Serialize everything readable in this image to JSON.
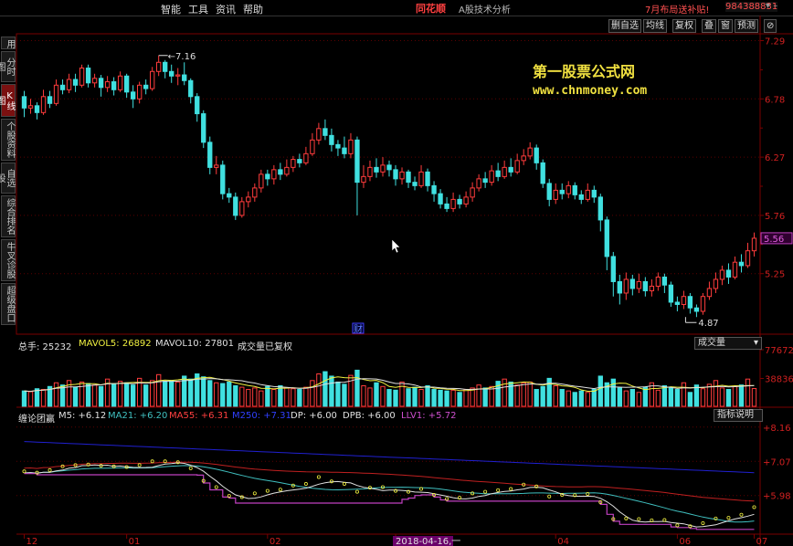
{
  "menu": {
    "items": [
      "智能",
      "工具",
      "资讯",
      "帮助"
    ],
    "brand": "同花顺",
    "subtitle": "A股技术分析",
    "promo": "7月布局送补贴!",
    "hotline": "984388831"
  },
  "sidebar": [
    {
      "label": "用",
      "active": false
    },
    {
      "label": "分时图",
      "active": false
    },
    {
      "label": "K线图",
      "active": true
    },
    {
      "label": "个股资料",
      "active": false
    },
    {
      "label": "自选股",
      "active": false
    },
    {
      "label": "综合排名",
      "active": false
    },
    {
      "label": "牛叉诊股",
      "active": false
    },
    {
      "label": "超级盘口",
      "active": false
    }
  ],
  "toolbar": [
    "删自选",
    "均线",
    "复权",
    "叠",
    "窗",
    "预测",
    "⊘"
  ],
  "watermark": {
    "line1": "第一股票公式网",
    "line2": "www.chnmoney.com"
  },
  "price_axis": {
    "ticks": [
      "7.29",
      "6.78",
      "6.27",
      "5.76",
      "5.25"
    ],
    "current": "5.56"
  },
  "annotations": {
    "high": "7.16",
    "low": "4.87",
    "cai": "财"
  },
  "volume_header": {
    "total": "总手: 25232",
    "mavol5": "MAVOL5: 26892",
    "mavol10": "MAVOL10: 27801",
    "note": "成交量已复权",
    "dropdown": "成交量"
  },
  "volume_axis": {
    "ticks": [
      "77672",
      "38836"
    ]
  },
  "indicator_header": {
    "name": "缠论团赢",
    "m5": "M5: +6.12",
    "ma21": "MA21: +6.20",
    "ma55": "MA55: +6.31",
    "m250": "M250: +7.31",
    "dp": "DP: +6.00",
    "dpb": "DPB: +6.00",
    "llv1": "LLV1: +5.72",
    "help": "指标说明"
  },
  "indicator_axis": {
    "ticks": [
      "8.16",
      "7.07",
      "5.98"
    ]
  },
  "time_axis": {
    "labels": [
      "12",
      "01",
      "02",
      "03",
      "04",
      "06",
      "07"
    ],
    "cursor_date": "2018-04-16,一"
  },
  "colors": {
    "up": "#ff3c3c",
    "down": "#40e0e0",
    "bg": "#000000",
    "grid": "#7a0000",
    "m5": "#e0e0e0",
    "ma21": "#40c0c0",
    "ma55": "#c02020",
    "m250": "#2020d0",
    "dp": "#c040c0",
    "llv": "#f0f040"
  },
  "chart_data": {
    "type": "candlestick",
    "title": "",
    "y_range": [
      4.72,
      7.35
    ],
    "labeled_extremes": {
      "high": 7.16,
      "low": 4.87
    },
    "candles": [
      [
        6.8,
        6.7,
        6.85,
        6.62
      ],
      [
        6.7,
        6.72,
        6.78,
        6.65
      ],
      [
        6.72,
        6.66,
        6.75,
        6.6
      ],
      [
        6.66,
        6.8,
        6.86,
        6.64
      ],
      [
        6.8,
        6.74,
        6.85,
        6.7
      ],
      [
        6.74,
        6.9,
        6.95,
        6.72
      ],
      [
        6.9,
        6.86,
        6.95,
        6.82
      ],
      [
        6.86,
        6.95,
        7.0,
        6.83
      ],
      [
        6.95,
        6.9,
        7.0,
        6.84
      ],
      [
        6.9,
        7.05,
        7.08,
        6.88
      ],
      [
        7.05,
        6.92,
        7.08,
        6.88
      ],
      [
        6.92,
        6.96,
        7.0,
        6.88
      ],
      [
        6.96,
        6.88,
        6.99,
        6.8
      ],
      [
        6.88,
        6.93,
        6.98,
        6.84
      ],
      [
        6.93,
        6.86,
        6.97,
        6.81
      ],
      [
        6.86,
        6.98,
        7.02,
        6.84
      ],
      [
        6.98,
        6.84,
        7.0,
        6.79
      ],
      [
        6.84,
        6.78,
        6.9,
        6.7
      ],
      [
        6.78,
        6.9,
        6.93,
        6.74
      ],
      [
        6.9,
        6.87,
        6.95,
        6.82
      ],
      [
        6.87,
        7.02,
        7.06,
        6.85
      ],
      [
        7.02,
        7.1,
        7.16,
        6.98
      ],
      [
        7.1,
        7.02,
        7.12,
        6.96
      ],
      [
        7.02,
        6.98,
        7.08,
        6.92
      ],
      [
        6.98,
        6.99,
        7.05,
        6.9
      ],
      [
        6.99,
        6.94,
        7.1,
        6.9
      ],
      [
        6.94,
        6.8,
        6.96,
        6.74
      ],
      [
        6.8,
        6.65,
        6.83,
        6.58
      ],
      [
        6.65,
        6.4,
        6.68,
        6.35
      ],
      [
        6.4,
        6.18,
        6.45,
        6.12
      ],
      [
        6.18,
        6.2,
        6.28,
        6.12
      ],
      [
        6.2,
        5.95,
        6.24,
        5.9
      ],
      [
        5.95,
        5.92,
        6.0,
        5.87
      ],
      [
        5.92,
        5.76,
        5.96,
        5.72
      ],
      [
        5.76,
        5.88,
        5.92,
        5.74
      ],
      [
        5.88,
        5.92,
        5.97,
        5.83
      ],
      [
        5.92,
        6.0,
        6.04,
        5.88
      ],
      [
        6.0,
        6.12,
        6.16,
        5.96
      ],
      [
        6.12,
        6.08,
        6.16,
        6.02
      ],
      [
        6.08,
        6.16,
        6.2,
        6.03
      ],
      [
        6.16,
        6.12,
        6.22,
        6.07
      ],
      [
        6.12,
        6.18,
        6.25,
        6.1
      ],
      [
        6.18,
        6.25,
        6.28,
        6.14
      ],
      [
        6.25,
        6.22,
        6.3,
        6.18
      ],
      [
        6.22,
        6.3,
        6.36,
        6.2
      ],
      [
        6.3,
        6.42,
        6.48,
        6.28
      ],
      [
        6.42,
        6.52,
        6.57,
        6.38
      ],
      [
        6.52,
        6.46,
        6.6,
        6.42
      ],
      [
        6.46,
        6.38,
        6.52,
        6.32
      ],
      [
        6.38,
        6.35,
        6.42,
        6.28
      ],
      [
        6.35,
        6.3,
        6.45,
        6.26
      ],
      [
        6.3,
        6.42,
        6.48,
        6.26
      ],
      [
        6.42,
        6.05,
        6.45,
        5.76
      ],
      [
        6.05,
        6.1,
        6.2,
        6.0
      ],
      [
        6.1,
        6.18,
        6.24,
        6.06
      ],
      [
        6.18,
        6.14,
        6.26,
        6.09
      ],
      [
        6.14,
        6.2,
        6.27,
        6.1
      ],
      [
        6.2,
        6.16,
        6.24,
        6.1
      ],
      [
        6.16,
        6.08,
        6.2,
        6.02
      ],
      [
        6.08,
        6.14,
        6.18,
        6.03
      ],
      [
        6.14,
        6.05,
        6.16,
        6.0
      ],
      [
        6.05,
        6.02,
        6.1,
        5.98
      ],
      [
        6.02,
        6.14,
        6.2,
        6.0
      ],
      [
        6.14,
        6.02,
        6.17,
        5.97
      ],
      [
        6.02,
        5.95,
        6.06,
        5.88
      ],
      [
        5.95,
        5.86,
        5.99,
        5.82
      ],
      [
        5.86,
        5.82,
        5.92,
        5.79
      ],
      [
        5.82,
        5.9,
        5.96,
        5.79
      ],
      [
        5.9,
        5.86,
        5.94,
        5.82
      ],
      [
        5.86,
        5.92,
        5.97,
        5.83
      ],
      [
        5.92,
        6.0,
        6.05,
        5.88
      ],
      [
        6.0,
        6.08,
        6.12,
        5.97
      ],
      [
        6.08,
        6.05,
        6.14,
        6.0
      ],
      [
        6.05,
        6.15,
        6.2,
        6.02
      ],
      [
        6.15,
        6.1,
        6.22,
        6.06
      ],
      [
        6.1,
        6.18,
        6.24,
        6.08
      ],
      [
        6.18,
        6.14,
        6.26,
        6.1
      ],
      [
        6.14,
        6.24,
        6.3,
        6.12
      ],
      [
        6.24,
        6.28,
        6.34,
        6.2
      ],
      [
        6.28,
        6.35,
        6.4,
        6.25
      ],
      [
        6.35,
        6.22,
        6.38,
        6.16
      ],
      [
        6.22,
        6.04,
        6.25,
        6.0
      ],
      [
        6.04,
        5.9,
        6.08,
        5.84
      ],
      [
        5.9,
        5.98,
        6.04,
        5.86
      ],
      [
        5.98,
        5.95,
        6.04,
        5.9
      ],
      [
        5.95,
        6.02,
        6.06,
        5.91
      ],
      [
        6.02,
        5.94,
        6.05,
        5.9
      ],
      [
        5.94,
        5.9,
        5.98,
        5.86
      ],
      [
        5.9,
        5.98,
        6.04,
        5.88
      ],
      [
        5.98,
        5.92,
        6.02,
        5.87
      ],
      [
        5.92,
        5.72,
        5.95,
        5.62
      ],
      [
        5.72,
        5.4,
        5.75,
        5.28
      ],
      [
        5.4,
        5.18,
        5.44,
        5.05
      ],
      [
        5.18,
        5.08,
        5.24,
        4.98
      ],
      [
        5.08,
        5.2,
        5.26,
        5.02
      ],
      [
        5.2,
        5.12,
        5.24,
        5.06
      ],
      [
        5.12,
        5.18,
        5.25,
        5.08
      ],
      [
        5.18,
        5.1,
        5.22,
        5.05
      ],
      [
        5.1,
        5.14,
        5.2,
        5.05
      ],
      [
        5.14,
        5.22,
        5.26,
        5.1
      ],
      [
        5.22,
        5.15,
        5.25,
        5.08
      ],
      [
        5.15,
        5.0,
        5.18,
        4.96
      ],
      [
        5.0,
        4.98,
        5.05,
        4.92
      ],
      [
        4.98,
        5.05,
        5.1,
        4.94
      ],
      [
        5.05,
        4.95,
        5.08,
        4.9
      ],
      [
        4.95,
        4.92,
        4.98,
        4.87
      ],
      [
        4.92,
        5.05,
        5.08,
        4.89
      ],
      [
        5.05,
        5.12,
        5.18,
        5.02
      ],
      [
        5.12,
        5.2,
        5.26,
        5.08
      ],
      [
        5.2,
        5.28,
        5.32,
        5.15
      ],
      [
        5.28,
        5.22,
        5.34,
        5.16
      ],
      [
        5.22,
        5.35,
        5.4,
        5.2
      ],
      [
        5.35,
        5.32,
        5.42,
        5.26
      ],
      [
        5.32,
        5.45,
        5.52,
        5.3
      ],
      [
        5.45,
        5.56,
        5.61,
        5.4
      ]
    ],
    "volume_y_range": [
      0,
      77672
    ],
    "volume": [
      22000,
      21000,
      25000,
      24000,
      28000,
      33000,
      30000,
      36000,
      27000,
      34000,
      32000,
      30000,
      28000,
      38000,
      31000,
      35000,
      33000,
      30000,
      39000,
      30000,
      36000,
      44000,
      35000,
      36000,
      34000,
      42000,
      38000,
      45000,
      41000,
      36000,
      33000,
      32000,
      34000,
      29000,
      27000,
      24000,
      26000,
      22000,
      28000,
      24000,
      29000,
      26000,
      25000,
      24000,
      27000,
      36000,
      45000,
      48000,
      42000,
      34000,
      31000,
      43000,
      50000,
      29000,
      26000,
      33000,
      28000,
      24000,
      23000,
      34000,
      25000,
      27000,
      24000,
      29000,
      24000,
      23000,
      22000,
      23000,
      20000,
      24000,
      26000,
      30000,
      26000,
      28000,
      35000,
      38000,
      34000,
      30000,
      33000,
      34000,
      24000,
      28000,
      39000,
      29000,
      24000,
      22000,
      20000,
      22000,
      20000,
      24000,
      42000,
      33000,
      38000,
      26000,
      22000,
      24000,
      20000,
      27000,
      33000,
      23000,
      29000,
      26000,
      24000,
      33000,
      20000,
      30000,
      25000,
      31000,
      36000,
      26000,
      24000,
      28000,
      30000,
      38000,
      25232
    ]
  }
}
